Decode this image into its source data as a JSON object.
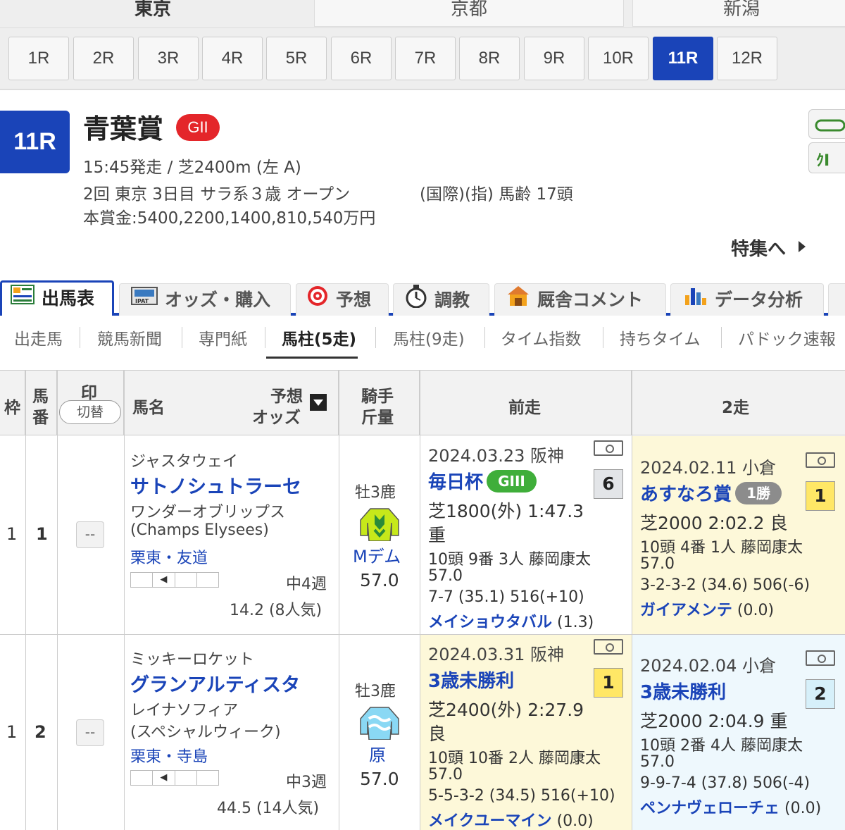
{
  "venues": [
    "東京",
    "京都",
    "新潟"
  ],
  "races": [
    "1R",
    "2R",
    "3R",
    "4R",
    "5R",
    "6R",
    "7R",
    "8R",
    "9R",
    "10R",
    "11R",
    "12R"
  ],
  "race": {
    "number": "11R",
    "name": "青葉賞",
    "grade": "GII",
    "line1": "15:45発走 / 芝2400m (左 A)",
    "line2a": "2回 東京 3日目 サラ系３歳 オープン",
    "line2b": "(国際)(指) 馬齢 17頭",
    "line3": "本賞金:5400,2200,1400,810,540万円",
    "feature": "特集へ"
  },
  "main_tabs": [
    "出馬表",
    "オッズ・購入",
    "予想",
    "調教",
    "厩舎コメント",
    "データ分析"
  ],
  "sub_tabs": [
    "出走馬",
    "競馬新聞",
    "専門紙",
    "馬柱(5走)",
    "馬柱(9走)",
    "タイム指数",
    "持ちタイム",
    "パドック速報"
  ],
  "headers": {
    "waku": "枠",
    "umaban1": "馬",
    "umaban2": "番",
    "mark": "印",
    "mark_toggle": "切替",
    "horse": "馬名",
    "odds1": "予想",
    "odds2": "オッズ",
    "jockey1": "騎手",
    "jockey2": "斤量",
    "prev1": "前走",
    "prev2": "2走"
  },
  "entries": [
    {
      "waku": "1",
      "umaban": "1",
      "mark": "--",
      "sire": "ジャスタウェイ",
      "name": "サトノシュトラーセ",
      "dam": "ワンダーオブリップス",
      "damsire": "(Champs Elysees)",
      "trainer": "栗東・友道",
      "interval": "中4週",
      "odds": "14.2 (8人気)",
      "sexage": "牡3鹿",
      "jockey": "Mデム",
      "weight": "57.0",
      "prev1": {
        "date": "2024.03.23 阪神",
        "race": "毎日杯",
        "grade": "GIII",
        "pos": "6",
        "course": "芝1800(外) 1:47.3",
        "cond": "重",
        "detail": "10頭 9番 3人 藤岡康太",
        "wt": "57.0",
        "pass": "7-7 (35.1) 516(+10)",
        "rival": "メイショウタバル",
        "diff": "(1.3)"
      },
      "prev2": {
        "date": "2024.02.11 小倉",
        "race": "あすなろ賞",
        "grade": "1勝",
        "pos": "1",
        "course": "芝2000 2:02.2 良",
        "detail": "10頭 4番 1人 藤岡康太",
        "wt": "57.0",
        "pass": "3-2-3-2 (34.6) 506(-6)",
        "rival": "ガイアメンテ",
        "diff": "(0.0)"
      }
    },
    {
      "waku": "1",
      "umaban": "2",
      "mark": "--",
      "sire": "ミッキーロケット",
      "name": "グランアルティスタ",
      "dam": "レイナソフィア",
      "damsire": "(スペシャルウィーク)",
      "trainer": "栗東・寺島",
      "interval": "中3週",
      "odds": "44.5 (14人気)",
      "sexage": "牡3鹿",
      "jockey": "原",
      "weight": "57.0",
      "prev1": {
        "date": "2024.03.31 阪神",
        "race": "3歳未勝利",
        "pos": "1",
        "course": "芝2400(外) 2:27.9",
        "cond": "良",
        "detail": "10頭 10番 2人 藤岡康太",
        "wt": "57.0",
        "pass": "5-5-3-2 (34.5) 516(+10)",
        "rival": "メイクユーマイン",
        "diff": "(0.0)"
      },
      "prev2": {
        "date": "2024.02.04 小倉",
        "race": "3歳未勝利",
        "pos": "2",
        "course": "芝2000 2:04.9 重",
        "detail": "10頭 2番 4人 藤岡康太",
        "wt": "57.0",
        "pass": "9-9-7-4 (37.8) 506(-4)",
        "rival": "ペンナヴェローチェ",
        "diff": "(0.0)"
      }
    }
  ],
  "colors": {
    "accent": "#1a44b8",
    "grade_g2": "#e4262a",
    "grade_g3": "#3fae3a",
    "grade_1win": "#8c8c8c",
    "win_bg": "#fdf8d9",
    "second_bg": "#eef8fd",
    "pos_yellow": "#ffe766",
    "pos_blue": "#d6f0fa"
  },
  "icons": [
    "race-card-icon",
    "ipat-icon",
    "target-icon",
    "stopwatch-icon",
    "stable-icon",
    "bar-chart-icon",
    "video-icon",
    "silks-icon"
  ]
}
